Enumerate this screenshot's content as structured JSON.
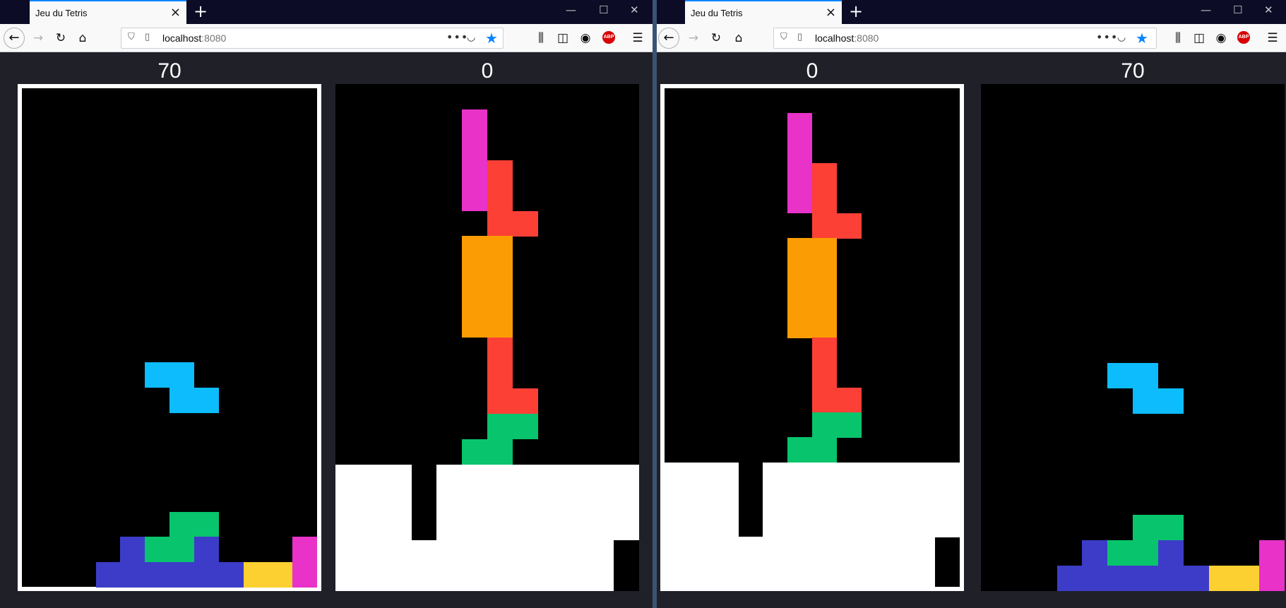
{
  "windows": [
    {
      "tab_title": "Jeu du Tetris",
      "url_host": "localhost",
      "url_port": ":8080",
      "players": [
        {
          "score": "70",
          "active": true
        },
        {
          "score": "0",
          "active": false
        }
      ]
    },
    {
      "tab_title": "Jeu du Tetris",
      "url_host": "localhost",
      "url_port": ":8080",
      "players": [
        {
          "score": "0",
          "active": true
        },
        {
          "score": "70",
          "active": false
        }
      ]
    }
  ],
  "icons": {
    "back": "back-arrow-icon",
    "forward": "forward-arrow-icon",
    "reload": "reload-icon",
    "home": "home-icon",
    "library": "library-icon",
    "sidebar": "sidebar-icon",
    "account": "account-icon",
    "adblock": "ABP",
    "menu": "hamburger-menu-icon"
  },
  "colors": {
    "cyan": "#0cbcfc",
    "blue": "#3c3cc8",
    "green": "#08c46c",
    "yellow": "#fcd030",
    "magenta": "#e832c8",
    "red": "#fc4036",
    "orange": "#fc9c04",
    "background": "#000000",
    "board_outline": "#ffffff"
  },
  "boards": {
    "A": {
      "cols": 12,
      "rows": 20,
      "cells": [
        {
          "c": 5,
          "r": 11,
          "color": "cyan"
        },
        {
          "c": 6,
          "r": 11,
          "color": "cyan"
        },
        {
          "c": 6,
          "r": 12,
          "color": "cyan"
        },
        {
          "c": 7,
          "r": 12,
          "color": "cyan"
        },
        {
          "c": 6,
          "r": 17,
          "color": "green"
        },
        {
          "c": 7,
          "r": 17,
          "color": "green"
        },
        {
          "c": 4,
          "r": 18,
          "color": "blue"
        },
        {
          "c": 5,
          "r": 18,
          "color": "green"
        },
        {
          "c": 6,
          "r": 18,
          "color": "green"
        },
        {
          "c": 7,
          "r": 18,
          "color": "blue"
        },
        {
          "c": 11,
          "r": 18,
          "color": "magenta"
        },
        {
          "c": 3,
          "r": 19,
          "color": "blue"
        },
        {
          "c": 4,
          "r": 19,
          "color": "blue"
        },
        {
          "c": 5,
          "r": 19,
          "color": "blue"
        },
        {
          "c": 6,
          "r": 19,
          "color": "blue"
        },
        {
          "c": 7,
          "r": 19,
          "color": "blue"
        },
        {
          "c": 8,
          "r": 19,
          "color": "blue"
        },
        {
          "c": 9,
          "r": 19,
          "color": "yellow"
        },
        {
          "c": 10,
          "r": 19,
          "color": "yellow"
        },
        {
          "c": 11,
          "r": 19,
          "color": "magenta"
        }
      ],
      "white_rows": []
    },
    "B": {
      "cols": 12,
      "rows": 20,
      "cells": [
        {
          "c": 5,
          "r": 1,
          "color": "magenta"
        },
        {
          "c": 5,
          "r": 2,
          "color": "magenta"
        },
        {
          "c": 5,
          "r": 3,
          "color": "magenta"
        },
        {
          "c": 5,
          "r": 4,
          "color": "magenta"
        },
        {
          "c": 6,
          "r": 3,
          "color": "red"
        },
        {
          "c": 6,
          "r": 4,
          "color": "red"
        },
        {
          "c": 6,
          "r": 5,
          "color": "red"
        },
        {
          "c": 7,
          "r": 5,
          "color": "red"
        },
        {
          "c": 5,
          "r": 6,
          "color": "orange"
        },
        {
          "c": 6,
          "r": 6,
          "color": "orange"
        },
        {
          "c": 5,
          "r": 7,
          "color": "orange"
        },
        {
          "c": 6,
          "r": 7,
          "color": "orange"
        },
        {
          "c": 5,
          "r": 8,
          "color": "orange"
        },
        {
          "c": 6,
          "r": 8,
          "color": "orange"
        },
        {
          "c": 5,
          "r": 9,
          "color": "orange"
        },
        {
          "c": 6,
          "r": 9,
          "color": "orange"
        },
        {
          "c": 6,
          "r": 10,
          "color": "red"
        },
        {
          "c": 6,
          "r": 11,
          "color": "red"
        },
        {
          "c": 6,
          "r": 12,
          "color": "red"
        },
        {
          "c": 7,
          "r": 12,
          "color": "red"
        },
        {
          "c": 6,
          "r": 13,
          "color": "green"
        },
        {
          "c": 7,
          "r": 13,
          "color": "green"
        },
        {
          "c": 5,
          "r": 14,
          "color": "green"
        },
        {
          "c": 6,
          "r": 14,
          "color": "green"
        }
      ],
      "white_rows": [
        {
          "r": 15,
          "holes": [
            3
          ]
        },
        {
          "r": 16,
          "holes": [
            3
          ]
        },
        {
          "r": 17,
          "holes": [
            3
          ]
        },
        {
          "r": 18,
          "holes": [
            11
          ]
        },
        {
          "r": 19,
          "holes": [
            11
          ]
        }
      ]
    }
  }
}
